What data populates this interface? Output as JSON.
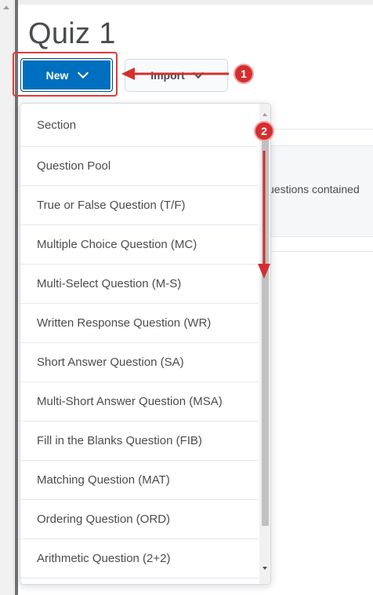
{
  "page": {
    "title": "Quiz 1"
  },
  "toolbar": {
    "new_label": "New",
    "import_label": "Import"
  },
  "background": {
    "partial_text": "uestions contained"
  },
  "dropdown": {
    "items": [
      {
        "label": "Section"
      },
      {
        "label": "Question Pool"
      },
      {
        "label": "True or False Question (T/F)"
      },
      {
        "label": "Multiple Choice Question (MC)"
      },
      {
        "label": "Multi-Select Question (M-S)"
      },
      {
        "label": "Written Response Question (WR)"
      },
      {
        "label": "Short Answer Question (SA)"
      },
      {
        "label": "Multi-Short Answer Question (MSA)"
      },
      {
        "label": "Fill in the Blanks Question (FIB)"
      },
      {
        "label": "Matching Question (MAT)"
      },
      {
        "label": "Ordering Question (ORD)"
      },
      {
        "label": "Arithmetic Question (2+2)"
      }
    ]
  },
  "annotations": {
    "step1": "1",
    "step2": "2",
    "color": "#d32f2f"
  },
  "colors": {
    "primary_button": "#006fbf",
    "highlight_box": "#e53935"
  }
}
